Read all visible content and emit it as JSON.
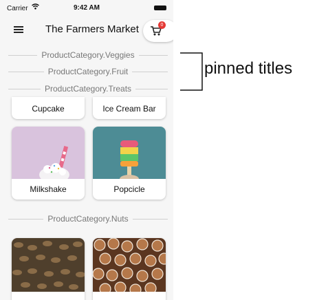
{
  "status": {
    "carrier": "Carrier",
    "time": "9:42 AM"
  },
  "app": {
    "title": "The Farmers Market",
    "cart_count": "0"
  },
  "categories": {
    "veggies": "ProductCategory.Veggies",
    "fruit": "ProductCategory.Fruit",
    "treats": "ProductCategory.Treats",
    "nuts": "ProductCategory.Nuts"
  },
  "products": {
    "cupcake": "Cupcake",
    "ice_cream_bar": "Ice Cream Bar",
    "milkshake": "Milkshake",
    "popcicle": "Popcicle"
  },
  "annotation": {
    "label": "pinned titles"
  },
  "colors": {
    "badge": "#e53935",
    "milkshake_bg": "#d9c3dd",
    "popcicle_bg": "#4d8c95",
    "nut_dark": "#5a4a35",
    "nut_light": "#a0683f"
  }
}
